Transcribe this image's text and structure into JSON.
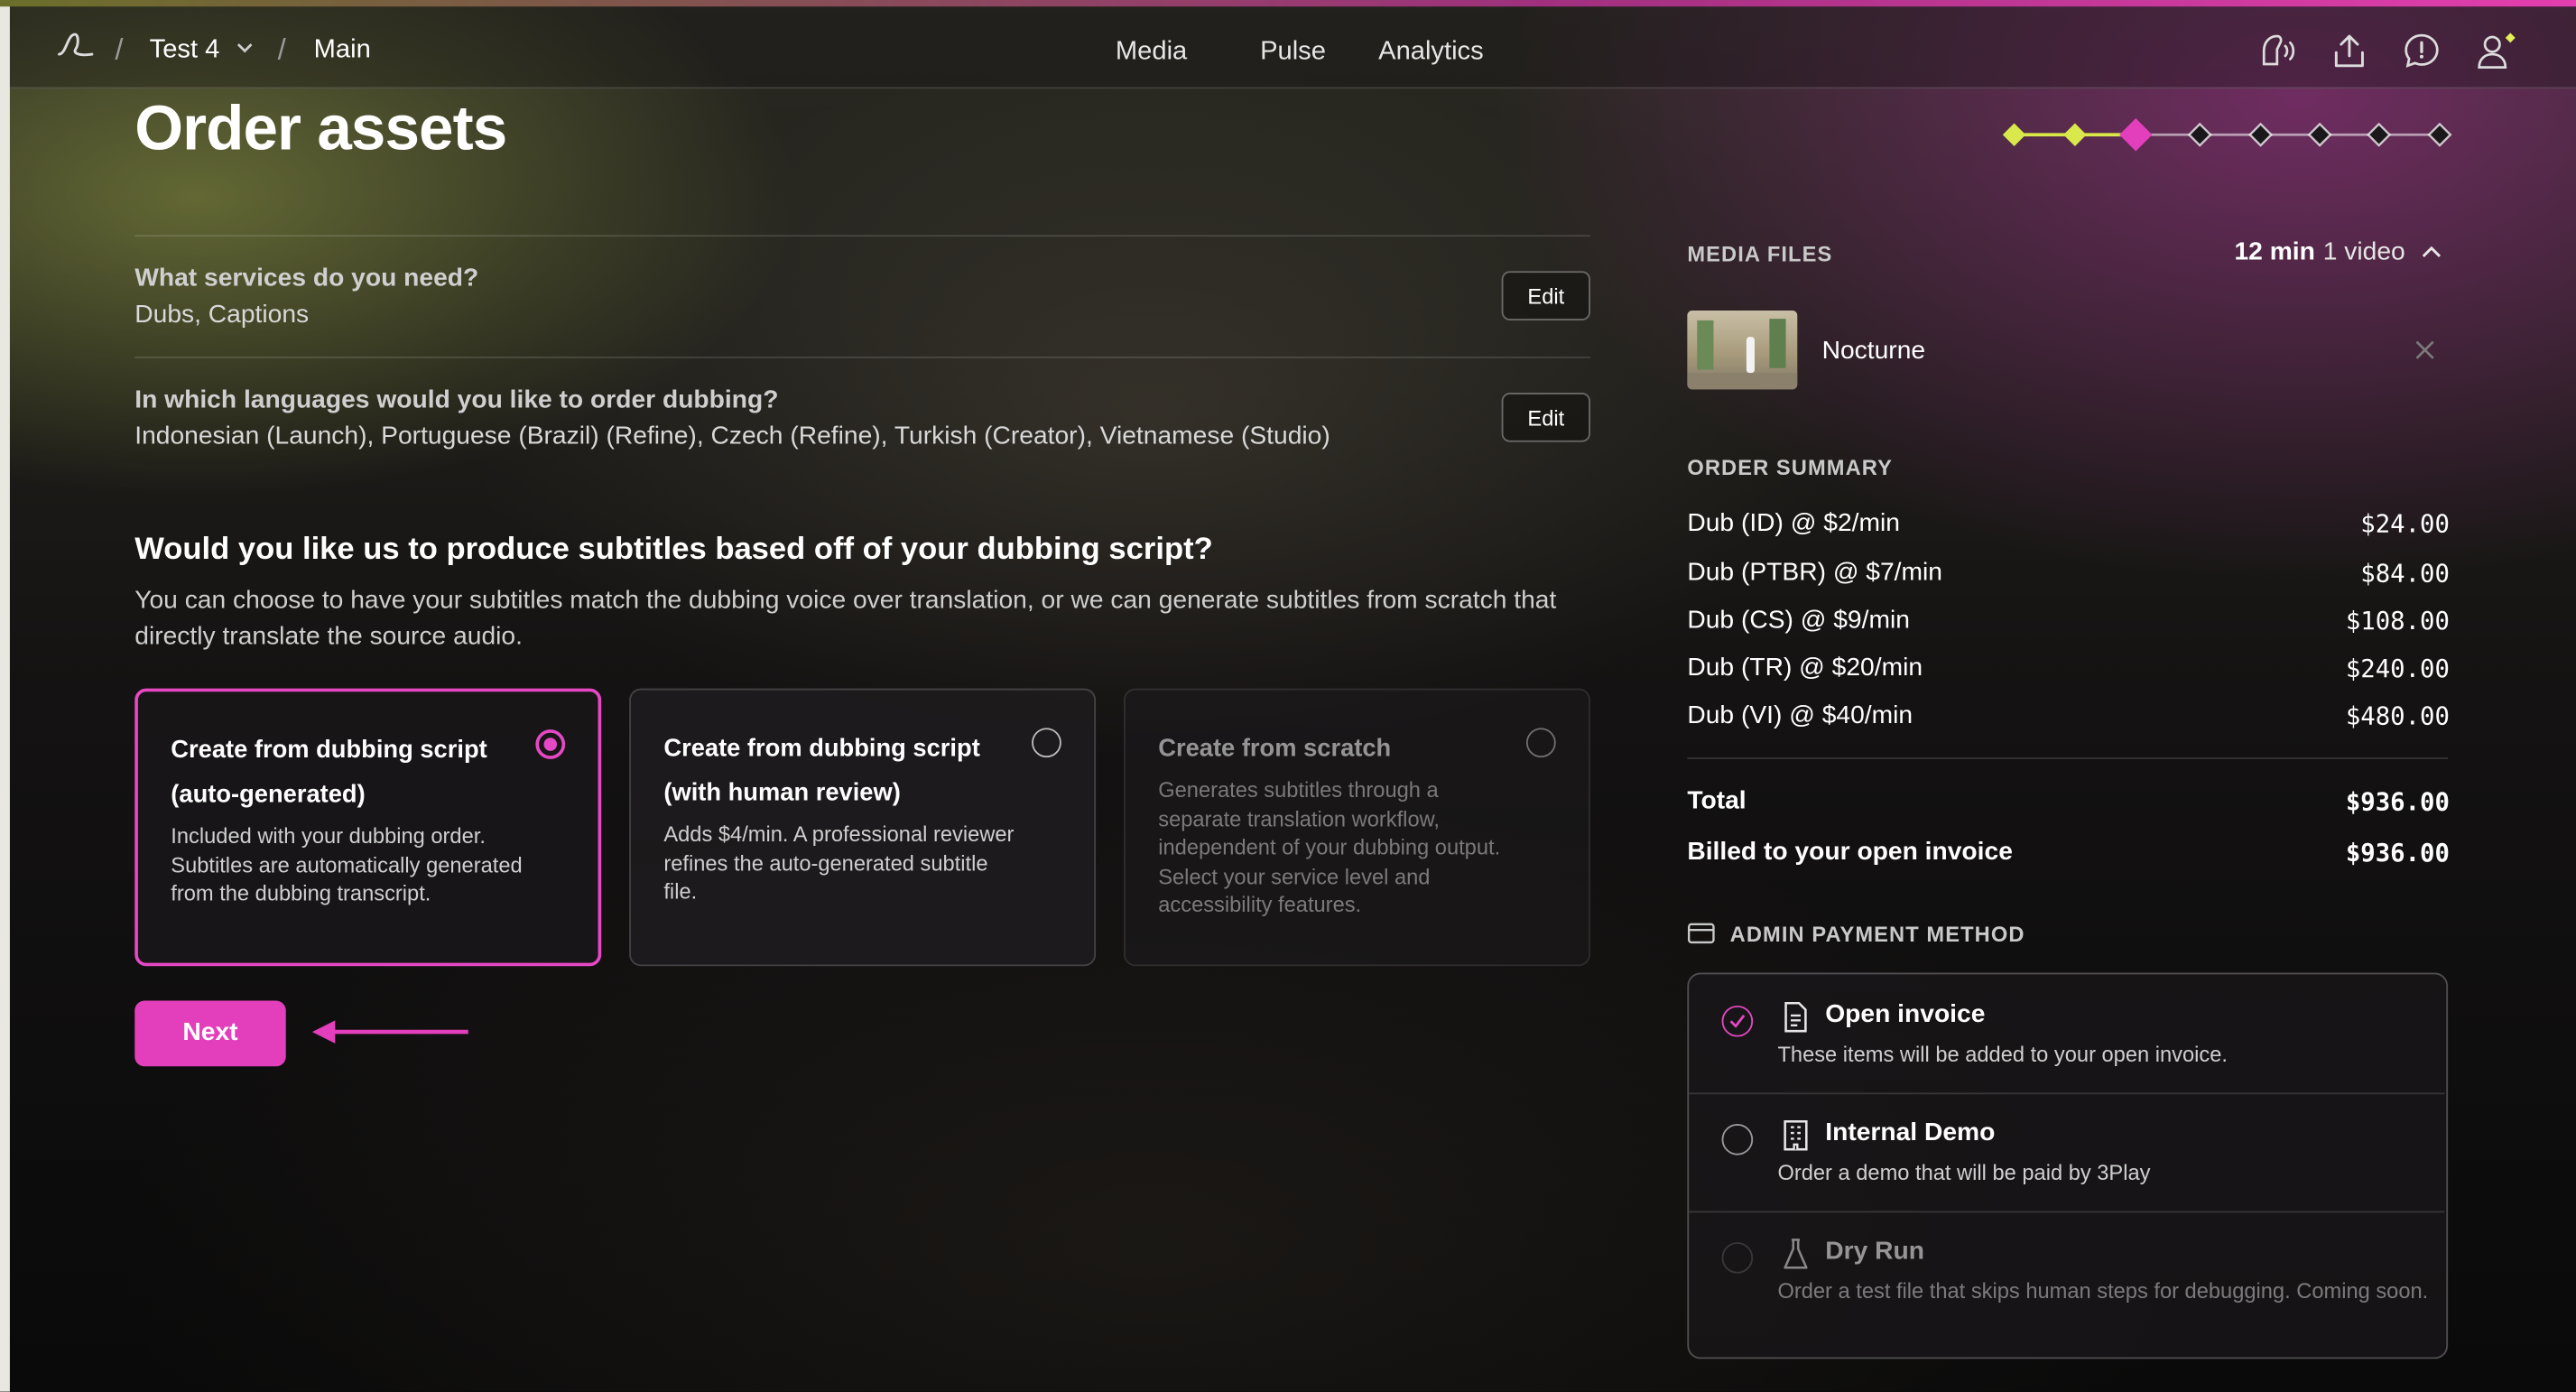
{
  "nav": {
    "breadcrumb": [
      "Test 4",
      "Main"
    ],
    "separator": "/",
    "links": [
      "Media",
      "Pulse",
      "Analytics"
    ]
  },
  "page": {
    "title": "Order assets"
  },
  "progress": {
    "total_steps": 8,
    "completed_steps": 2,
    "current_step": 3
  },
  "questions": [
    {
      "label": "What services do you need?",
      "value": "Dubs, Captions",
      "edit": "Edit"
    },
    {
      "label": "In which languages would you like to order dubbing?",
      "value": "Indonesian (Launch), Portuguese (Brazil) (Refine), Czech (Refine), Turkish (Creator), Vietnamese (Studio)",
      "edit": "Edit"
    }
  ],
  "subtitles": {
    "heading": "Would you like us to produce subtitles based off of your dubbing script?",
    "description": "You can choose to have your subtitles match the dubbing voice over translation, or we can generate subtitles from scratch that directly translate the source audio.",
    "options": [
      {
        "title": "Create from dubbing script (auto-generated)",
        "desc": "Included with your dubbing order. Subtitles are automatically generated from the dubbing transcript.",
        "selected": true,
        "disabled": false
      },
      {
        "title": "Create from dubbing script (with human review)",
        "desc": "Adds $4/min. A professional reviewer refines the auto-generated subtitle file.",
        "selected": false,
        "disabled": false
      },
      {
        "title": "Create from scratch",
        "desc": "Generates subtitles through a separate translation workflow, independent of your dubbing output. Select your service level and accessibility features.",
        "selected": false,
        "disabled": true
      }
    ],
    "next": "Next"
  },
  "media_files": {
    "heading": "MEDIA FILES",
    "duration": "12 min",
    "count": "1 video",
    "files": [
      {
        "name": "Nocturne"
      }
    ]
  },
  "order_summary": {
    "heading": "ORDER SUMMARY",
    "lines": [
      {
        "label": "Dub (ID) @ $2/min",
        "price": "$24.00"
      },
      {
        "label": "Dub (PTBR) @ $7/min",
        "price": "$84.00"
      },
      {
        "label": "Dub (CS) @ $9/min",
        "price": "$108.00"
      },
      {
        "label": "Dub (TR) @ $20/min",
        "price": "$240.00"
      },
      {
        "label": "Dub (VI) @ $40/min",
        "price": "$480.00"
      }
    ],
    "total_label": "Total",
    "total": "$936.00",
    "billed_label": "Billed to your open invoice",
    "billed": "$936.00"
  },
  "payment": {
    "heading": "ADMIN PAYMENT METHOD",
    "methods": [
      {
        "title": "Open invoice",
        "desc": "These items will be added to your open invoice.",
        "icon": "document-icon",
        "selected": true
      },
      {
        "title": "Internal Demo",
        "desc": "Order a demo that will be paid by 3Play",
        "icon": "building-icon",
        "selected": false
      },
      {
        "title": "Dry Run",
        "desc": "Order a test file that skips human steps for debugging. Coming soon.",
        "icon": "flask-icon",
        "selected": false,
        "disabled": true
      }
    ]
  },
  "colors": {
    "accent": "#e33fbc",
    "progress_done": "#d9e84a"
  }
}
